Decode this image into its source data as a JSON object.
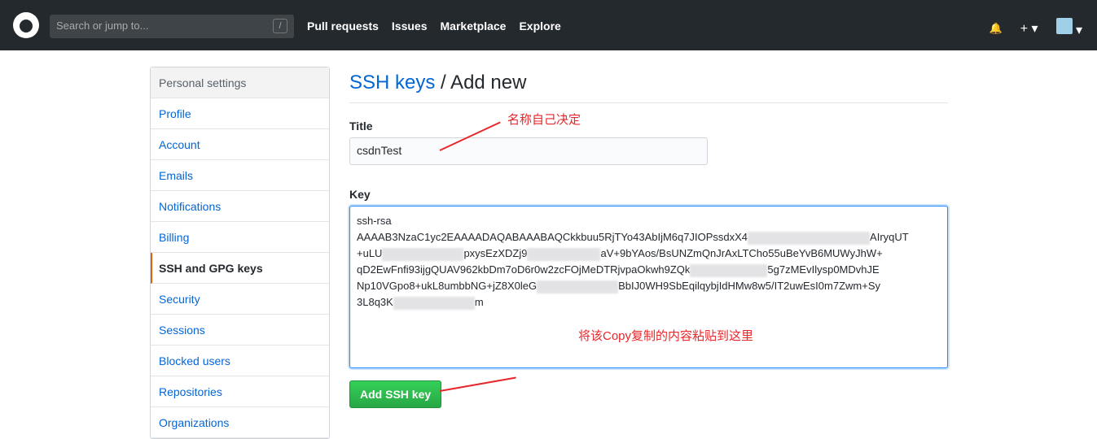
{
  "header": {
    "search_placeholder": "Search or jump to...",
    "slash": "/",
    "nav": [
      "Pull requests",
      "Issues",
      "Marketplace",
      "Explore"
    ],
    "bell": "🔔",
    "plus": "+ ▾",
    "avatar_caret": "▾"
  },
  "sidebar": {
    "heading": "Personal settings",
    "items": [
      "Profile",
      "Account",
      "Emails",
      "Notifications",
      "Billing",
      "SSH and GPG keys",
      "Security",
      "Sessions",
      "Blocked users",
      "Repositories",
      "Organizations"
    ],
    "selected": "SSH and GPG keys"
  },
  "main": {
    "title_link": "SSH keys",
    "title_rest": " / Add new",
    "title_label": "Title",
    "title_value": "csdnTest",
    "key_label": "Key",
    "key_lines": [
      "ssh-rsa",
      "AAAAB3NzaC1yc2EAAAADAQABAAABAQCkkbuu5RjTYo43AbIjM6q7JIOPssdxX4",
      "AIryqUT",
      "+uLU",
      "pxysEzXDZj9",
      "aV+9bYAos/BsUNZmQnJrAxLTCho55uBeYvB6MUWyJhW+",
      "qD2EwFnfi93ijgQUAV962kbDm7oD6r0w2zcFOjMeDTRjvpaOkwh9ZQk",
      "5g7zMEvIlysp0MDvhJE",
      "Np10VGpo8+ukL8umbbNG+jZ8X0leG",
      "BbIJ0WH9SbEqilqybjIdHMw8w5/IT2uwEsI0m7Zwm+Sy",
      "3L8q3K",
      "m"
    ],
    "submit": "Add SSH key"
  },
  "annotations": {
    "title_note": "名称自己决定",
    "key_note": "将该Copy复制的内容粘贴到这里"
  }
}
